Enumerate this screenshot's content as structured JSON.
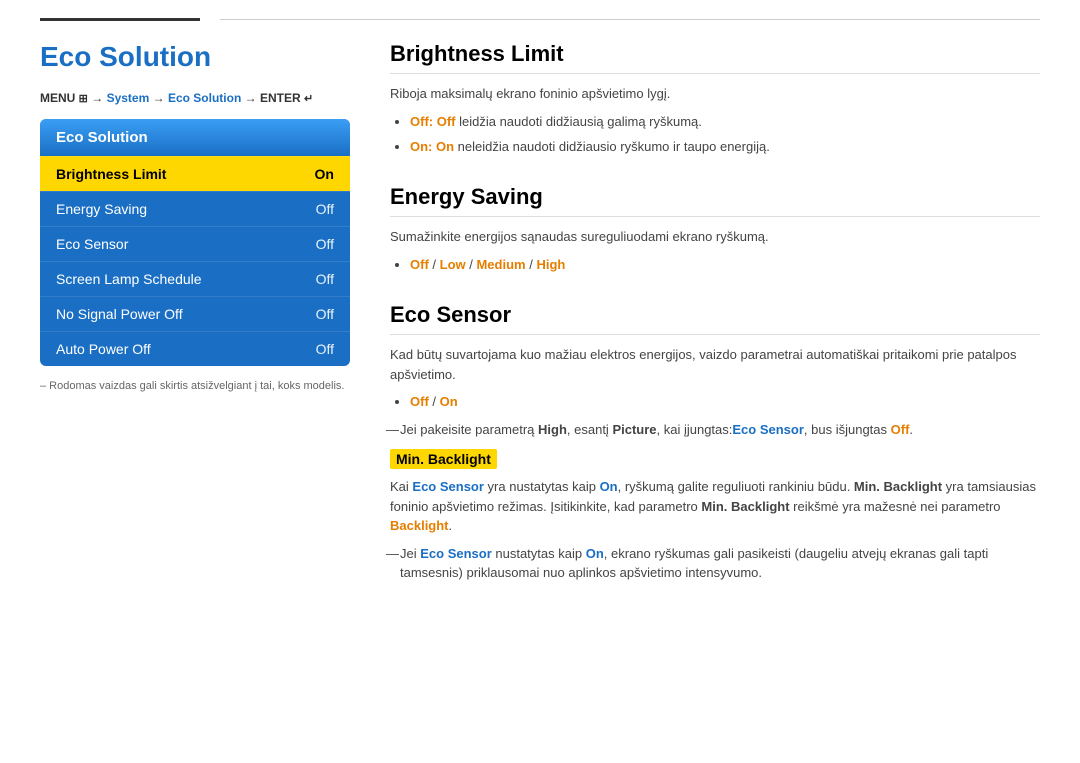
{
  "topbar": {
    "line_note": ""
  },
  "left": {
    "title": "Eco Solution",
    "menu_path_prefix": "MENU ",
    "menu_path_1": "System",
    "menu_path_arrow1": " → ",
    "menu_path_2": "Eco Solution",
    "menu_path_arrow2": " → ENTER ",
    "menu_enter_icon": "↵",
    "menu_header": "Eco Solution",
    "menu_items": [
      {
        "label": "Brightness Limit",
        "value": "On",
        "active": true
      },
      {
        "label": "Energy Saving",
        "value": "Off",
        "active": false
      },
      {
        "label": "Eco Sensor",
        "value": "Off",
        "active": false
      },
      {
        "label": "Screen Lamp Schedule",
        "value": "Off",
        "active": false
      },
      {
        "label": "No Signal Power Off",
        "value": "Off",
        "active": false
      },
      {
        "label": "Auto Power Off",
        "value": "Off",
        "active": false
      }
    ],
    "note": "– Rodomas vaizdas gali skirtis atsižvelgiant į tai, koks modelis."
  },
  "right": {
    "sections": [
      {
        "id": "brightness-limit",
        "title": "Brightness Limit",
        "paragraphs": [
          "Riboja maksimalų ekrano foninio apšvietimo lygį."
        ],
        "bullets": [
          {
            "prefix_bold": "Off: Off",
            "text": " leidžia naudoti didžiausią galimą ryškumą."
          },
          {
            "prefix_bold": "On: On",
            "text": " neleidžia naudoti didžiausio ryškumo ir taupo energiją."
          }
        ]
      },
      {
        "id": "energy-saving",
        "title": "Energy Saving",
        "paragraphs": [
          "Sumažinkite energijos sąnaudas sureguliuodami ekrano ryškumą."
        ],
        "bullets": [
          {
            "colored": "Off / Low / Medium / High"
          }
        ]
      },
      {
        "id": "eco-sensor",
        "title": "Eco Sensor",
        "paragraphs": [
          "Kad būtų suvartojama kuo mažiau elektros energijos, vaizdo parametrai automatiškai pritaikomi prie patalpos apšvietimo."
        ],
        "bullets": [
          {
            "colored": "Off / On"
          }
        ],
        "dash_note": "Jei pakeisite parametrą High, esantį Picture, kai įjungtas Eco Sensor, bus išjungtas Off.",
        "highlight": "Min. Backlight",
        "highlight_para": "Kai Eco Sensor yra nustatytas kaip On, ryškumą galite reguliuoti rankiniu būdu. Min. Backlight yra tamsiausias foninio apšvietimo režimas. Įsitikinkite, kad parametro Min. Backlight reikšmė yra mažesnė nei parametro Backlight.",
        "dash_note2": "Jei Eco Sensor nustatytas kaip On, ekrano ryškumas gali pasikeisti (daugeliu atvejų ekranas gali tapti tamsesnis) priklausomai nuo aplinkos apšvietimo intensyvumo."
      }
    ]
  }
}
